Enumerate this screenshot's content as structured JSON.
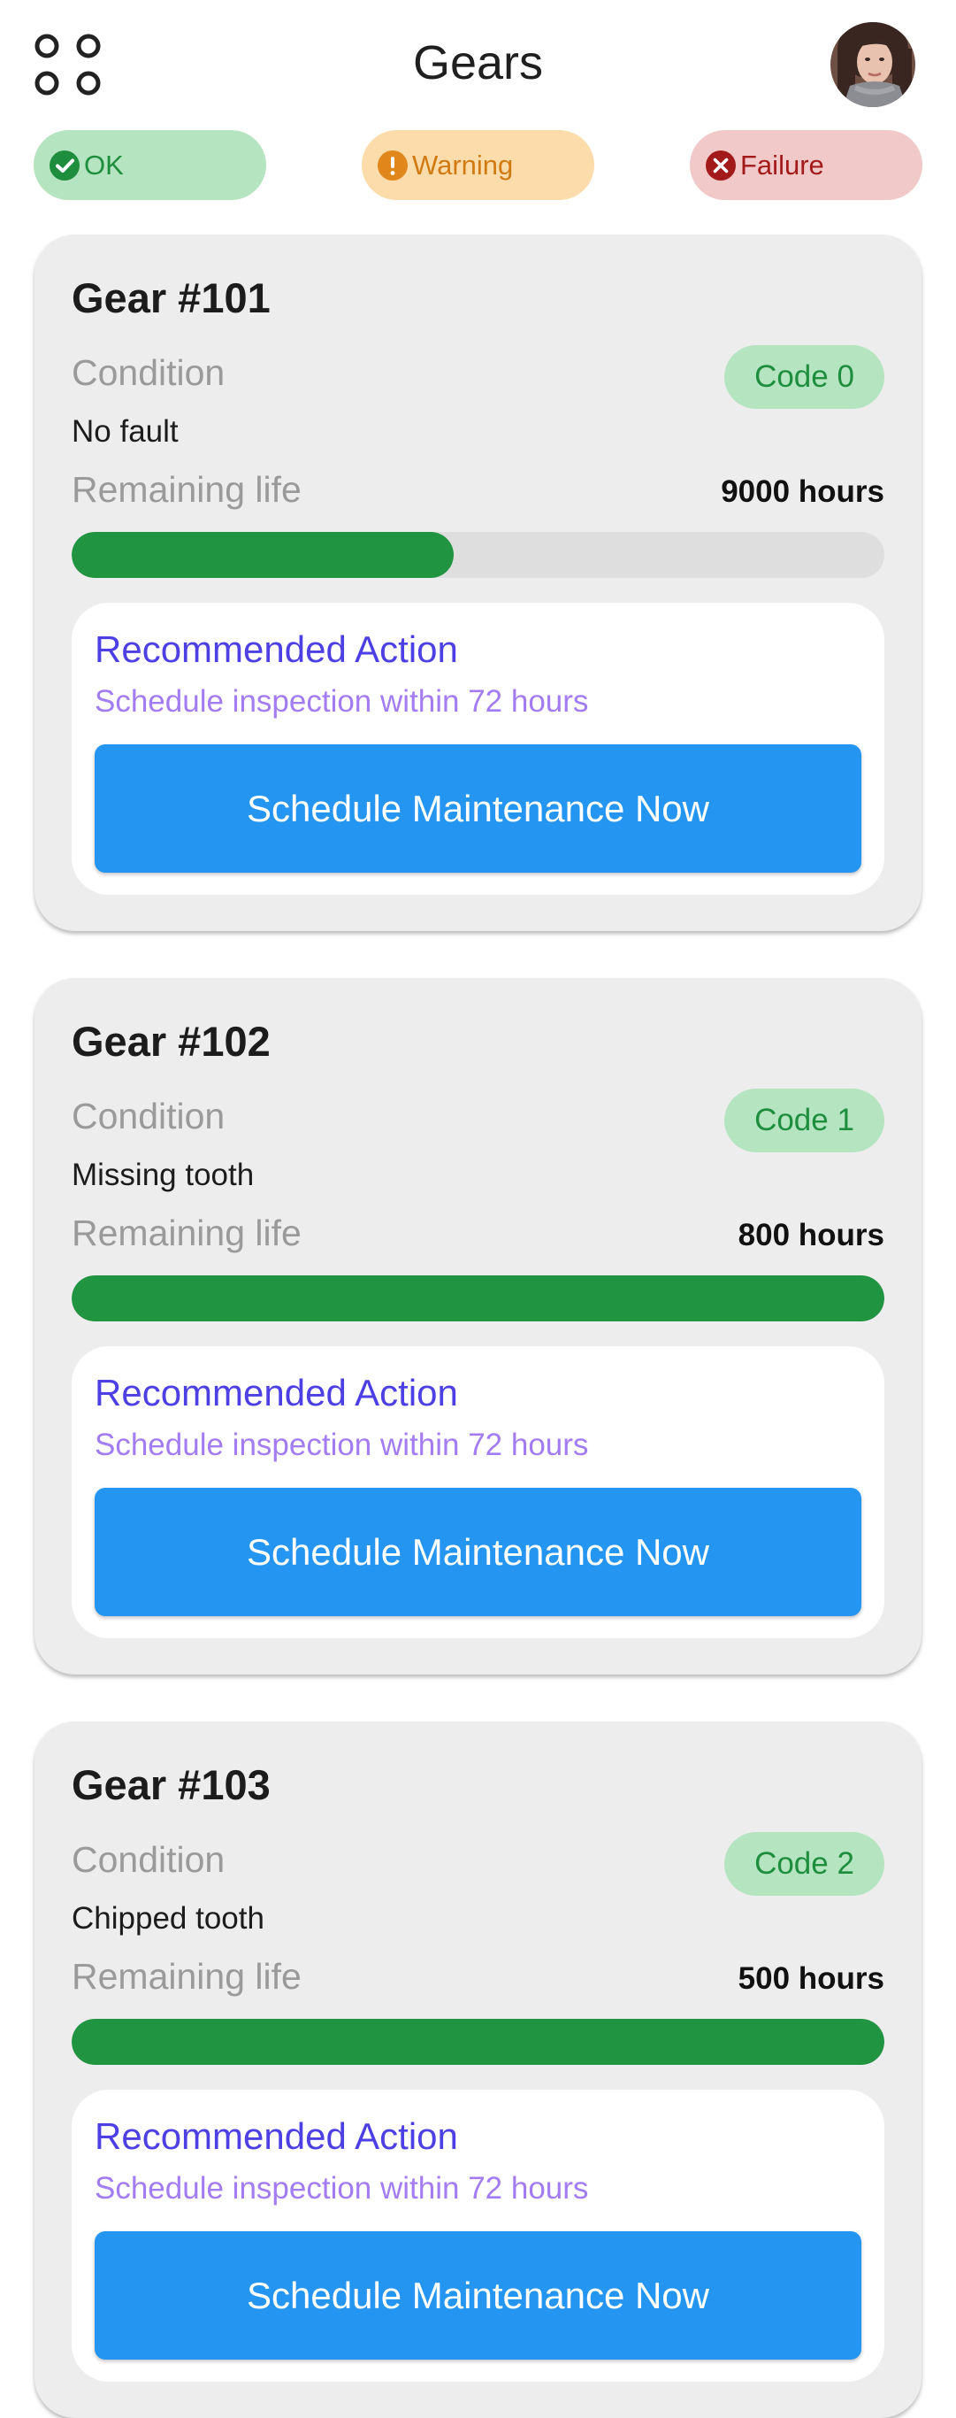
{
  "header": {
    "title": "Gears",
    "menu_icon": "grid-circles-icon",
    "avatar": "user-avatar"
  },
  "status_filters": [
    {
      "label": "OK",
      "icon": "check-circle-icon",
      "bg": "#b5e4c0",
      "fg": "#1e8e3e",
      "icon_color": "#1e8e3e"
    },
    {
      "label": "Warning",
      "icon": "exclamation-circle-icon",
      "bg": "#fddcab",
      "fg": "#d17a12",
      "icon_color": "#e0861b"
    },
    {
      "label": "Failure",
      "icon": "x-circle-icon",
      "bg": "#f2c9c9",
      "fg": "#a31a1a",
      "icon_color": "#a31a1a"
    }
  ],
  "cards": [
    {
      "title": "Gear #101",
      "condition_label": "Condition",
      "code": "Code 0",
      "condition": "No fault",
      "life_label": "Remaining life",
      "life": "9000 hours",
      "life_fraction": 0.47,
      "action_title": "Recommended Action",
      "action_text": "Schedule inspection within 72 hours",
      "button": "Schedule Maintenance Now"
    },
    {
      "title": "Gear #102",
      "condition_label": "Condition",
      "code": "Code 1",
      "condition": "Missing tooth",
      "life_label": "Remaining life",
      "life": "800 hours",
      "life_fraction": 1.0,
      "action_title": "Recommended Action",
      "action_text": "Schedule inspection within 72 hours",
      "button": "Schedule Maintenance Now"
    },
    {
      "title": "Gear #103",
      "condition_label": "Condition",
      "code": "Code 2",
      "condition": "Chipped tooth",
      "life_label": "Remaining life",
      "life": "500 hours",
      "life_fraction": 1.0,
      "action_title": "Recommended Action",
      "action_text": "Schedule inspection within 72 hours",
      "button": "Schedule Maintenance Now"
    }
  ],
  "colors": {
    "code_badge_bg": "#b5e4c0",
    "code_badge_fg": "#1e8e3e",
    "progress_fill": "#219441",
    "button": "#2595f2"
  }
}
